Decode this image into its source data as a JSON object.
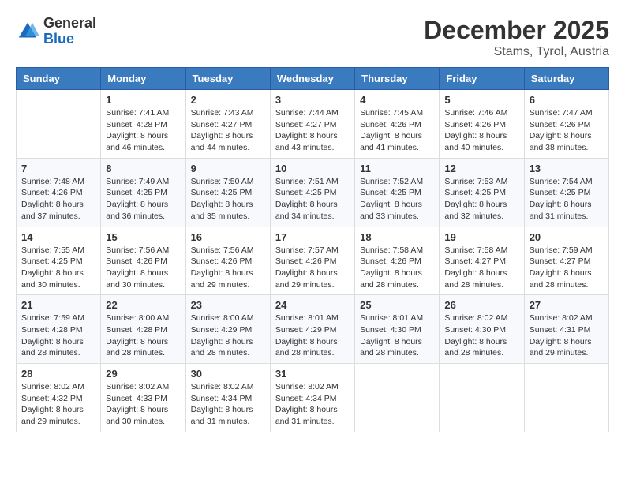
{
  "header": {
    "logo": {
      "general": "General",
      "blue": "Blue"
    },
    "title": "December 2025",
    "subtitle": "Stams, Tyrol, Austria"
  },
  "weekdays": [
    "Sunday",
    "Monday",
    "Tuesday",
    "Wednesday",
    "Thursday",
    "Friday",
    "Saturday"
  ],
  "weeks": [
    [
      {
        "day": null
      },
      {
        "day": 1,
        "sunrise": "7:41 AM",
        "sunset": "4:28 PM",
        "daylight": "8 hours and 46 minutes."
      },
      {
        "day": 2,
        "sunrise": "7:43 AM",
        "sunset": "4:27 PM",
        "daylight": "8 hours and 44 minutes."
      },
      {
        "day": 3,
        "sunrise": "7:44 AM",
        "sunset": "4:27 PM",
        "daylight": "8 hours and 43 minutes."
      },
      {
        "day": 4,
        "sunrise": "7:45 AM",
        "sunset": "4:26 PM",
        "daylight": "8 hours and 41 minutes."
      },
      {
        "day": 5,
        "sunrise": "7:46 AM",
        "sunset": "4:26 PM",
        "daylight": "8 hours and 40 minutes."
      },
      {
        "day": 6,
        "sunrise": "7:47 AM",
        "sunset": "4:26 PM",
        "daylight": "8 hours and 38 minutes."
      }
    ],
    [
      {
        "day": 7,
        "sunrise": "7:48 AM",
        "sunset": "4:26 PM",
        "daylight": "8 hours and 37 minutes."
      },
      {
        "day": 8,
        "sunrise": "7:49 AM",
        "sunset": "4:25 PM",
        "daylight": "8 hours and 36 minutes."
      },
      {
        "day": 9,
        "sunrise": "7:50 AM",
        "sunset": "4:25 PM",
        "daylight": "8 hours and 35 minutes."
      },
      {
        "day": 10,
        "sunrise": "7:51 AM",
        "sunset": "4:25 PM",
        "daylight": "8 hours and 34 minutes."
      },
      {
        "day": 11,
        "sunrise": "7:52 AM",
        "sunset": "4:25 PM",
        "daylight": "8 hours and 33 minutes."
      },
      {
        "day": 12,
        "sunrise": "7:53 AM",
        "sunset": "4:25 PM",
        "daylight": "8 hours and 32 minutes."
      },
      {
        "day": 13,
        "sunrise": "7:54 AM",
        "sunset": "4:25 PM",
        "daylight": "8 hours and 31 minutes."
      }
    ],
    [
      {
        "day": 14,
        "sunrise": "7:55 AM",
        "sunset": "4:25 PM",
        "daylight": "8 hours and 30 minutes."
      },
      {
        "day": 15,
        "sunrise": "7:56 AM",
        "sunset": "4:26 PM",
        "daylight": "8 hours and 30 minutes."
      },
      {
        "day": 16,
        "sunrise": "7:56 AM",
        "sunset": "4:26 PM",
        "daylight": "8 hours and 29 minutes."
      },
      {
        "day": 17,
        "sunrise": "7:57 AM",
        "sunset": "4:26 PM",
        "daylight": "8 hours and 29 minutes."
      },
      {
        "day": 18,
        "sunrise": "7:58 AM",
        "sunset": "4:26 PM",
        "daylight": "8 hours and 28 minutes."
      },
      {
        "day": 19,
        "sunrise": "7:58 AM",
        "sunset": "4:27 PM",
        "daylight": "8 hours and 28 minutes."
      },
      {
        "day": 20,
        "sunrise": "7:59 AM",
        "sunset": "4:27 PM",
        "daylight": "8 hours and 28 minutes."
      }
    ],
    [
      {
        "day": 21,
        "sunrise": "7:59 AM",
        "sunset": "4:28 PM",
        "daylight": "8 hours and 28 minutes."
      },
      {
        "day": 22,
        "sunrise": "8:00 AM",
        "sunset": "4:28 PM",
        "daylight": "8 hours and 28 minutes."
      },
      {
        "day": 23,
        "sunrise": "8:00 AM",
        "sunset": "4:29 PM",
        "daylight": "8 hours and 28 minutes."
      },
      {
        "day": 24,
        "sunrise": "8:01 AM",
        "sunset": "4:29 PM",
        "daylight": "8 hours and 28 minutes."
      },
      {
        "day": 25,
        "sunrise": "8:01 AM",
        "sunset": "4:30 PM",
        "daylight": "8 hours and 28 minutes."
      },
      {
        "day": 26,
        "sunrise": "8:02 AM",
        "sunset": "4:30 PM",
        "daylight": "8 hours and 28 minutes."
      },
      {
        "day": 27,
        "sunrise": "8:02 AM",
        "sunset": "4:31 PM",
        "daylight": "8 hours and 29 minutes."
      }
    ],
    [
      {
        "day": 28,
        "sunrise": "8:02 AM",
        "sunset": "4:32 PM",
        "daylight": "8 hours and 29 minutes."
      },
      {
        "day": 29,
        "sunrise": "8:02 AM",
        "sunset": "4:33 PM",
        "daylight": "8 hours and 30 minutes."
      },
      {
        "day": 30,
        "sunrise": "8:02 AM",
        "sunset": "4:34 PM",
        "daylight": "8 hours and 31 minutes."
      },
      {
        "day": 31,
        "sunrise": "8:02 AM",
        "sunset": "4:34 PM",
        "daylight": "8 hours and 31 minutes."
      },
      {
        "day": null
      },
      {
        "day": null
      },
      {
        "day": null
      }
    ]
  ],
  "labels": {
    "sunrise": "Sunrise:",
    "sunset": "Sunset:",
    "daylight": "Daylight:"
  }
}
